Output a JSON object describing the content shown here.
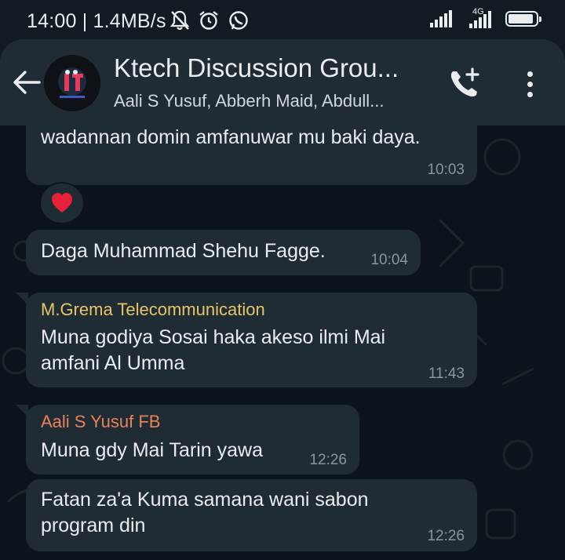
{
  "status_bar": {
    "time": "14:00 | 1.4MB/s",
    "network_label": "4G",
    "battery_level": 0.9
  },
  "header": {
    "title": "Ktech Discussion Grou...",
    "subtitle": "Aali S Yusuf, Abberh Maid, Abdull..."
  },
  "messages": [
    {
      "text": "wadannan domin amfanuwar mu baki daya.",
      "time": "10:03",
      "reaction": "❤️"
    },
    {
      "text": "Daga Muhammad Shehu Fagge.",
      "time": "10:04"
    },
    {
      "sender": "M.Grema Telecommunication",
      "sender_color": "#e6c46a",
      "text": "Muna godiya Sosai haka akeso ilmi Mai amfani Al Umma",
      "time": "11:43"
    },
    {
      "sender": "Aali S Yusuf FB",
      "sender_color": "#e8825a",
      "text": "Muna gdy Mai Tarin yawa",
      "time": "12:26"
    },
    {
      "text": "Fatan za'a Kuma samana wani sabon program din",
      "time": "12:26"
    }
  ],
  "colors": {
    "bubble": "#202c33",
    "background": "#0b141a",
    "header": "#1f2c34",
    "timestamp": "#8696a0"
  }
}
